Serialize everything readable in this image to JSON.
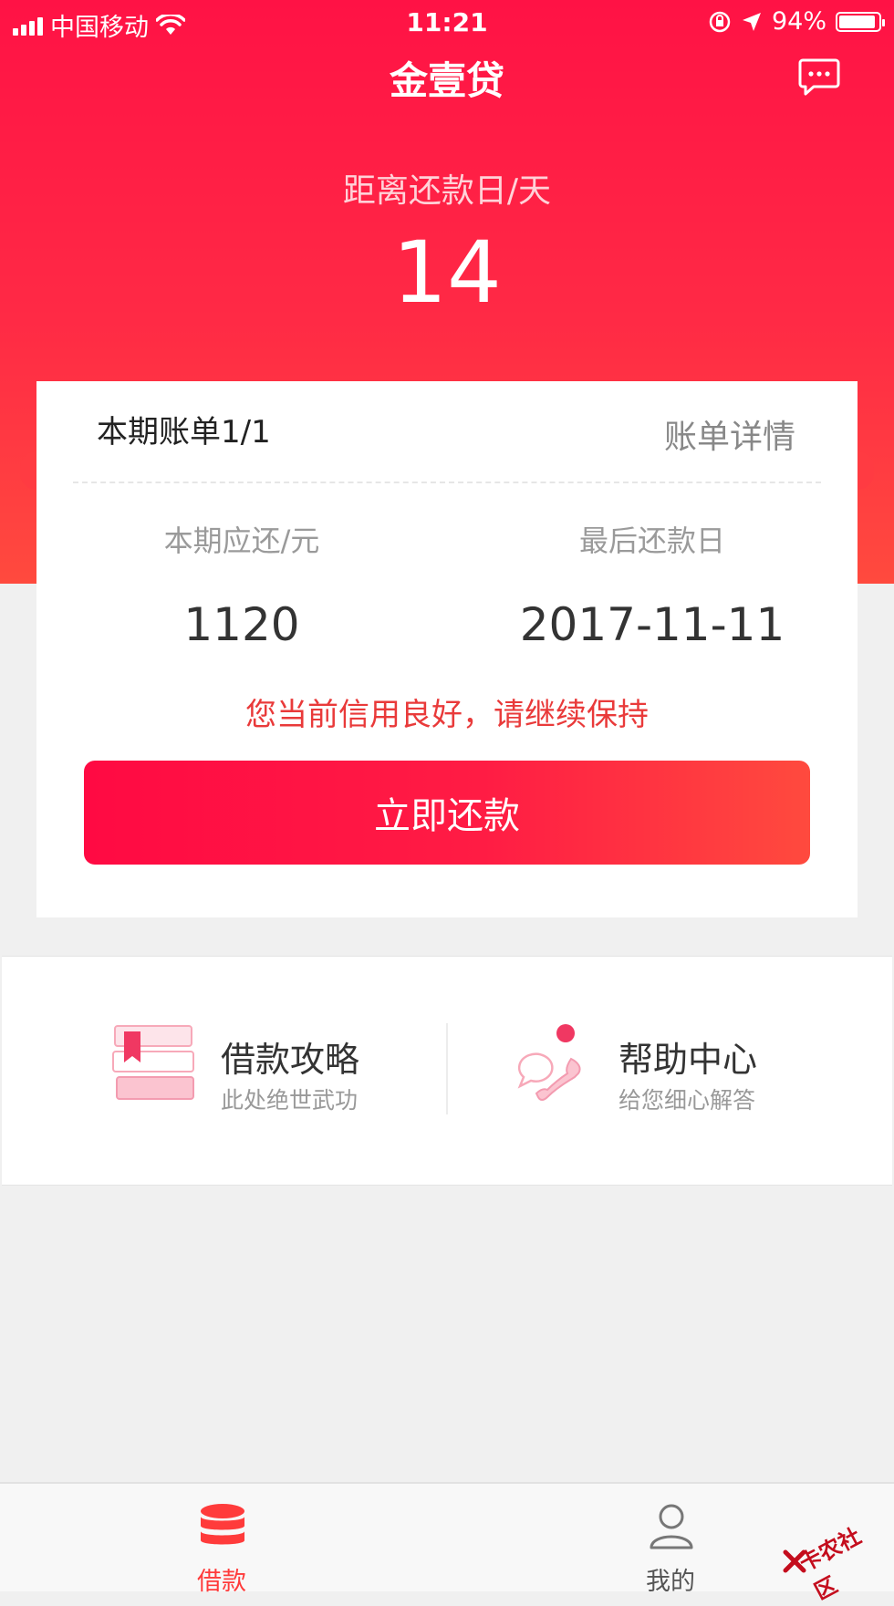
{
  "status_bar": {
    "carrier": "中国移动",
    "time": "11:21",
    "battery": "94%"
  },
  "header": {
    "title": "金壹贷",
    "message_icon": "chat-bubble-icon"
  },
  "countdown": {
    "label": "距离还款日/天",
    "value": "14"
  },
  "bill_card": {
    "title": "本期账单1/1",
    "detail_link": "账单详情",
    "due_amount_label": "本期应还/元",
    "due_amount": "1120",
    "last_date_label": "最后还款日",
    "last_date": "2017-11-11",
    "credit_message": "您当前信用良好，请继续保持",
    "repay_button": "立即还款"
  },
  "services": [
    {
      "title": "借款攻略",
      "subtitle": "此处绝世武功",
      "icon": "books-icon"
    },
    {
      "title": "帮助中心",
      "subtitle": "给您细心解答",
      "icon": "phone-chat-icon"
    }
  ],
  "tabbar": {
    "loan": "借款",
    "mine": "我的"
  },
  "watermark": "卡农社区",
  "colors": {
    "brand_red": "#ff1245",
    "accent_orange": "#ff4a3e",
    "credit_text": "#e93a3a"
  }
}
